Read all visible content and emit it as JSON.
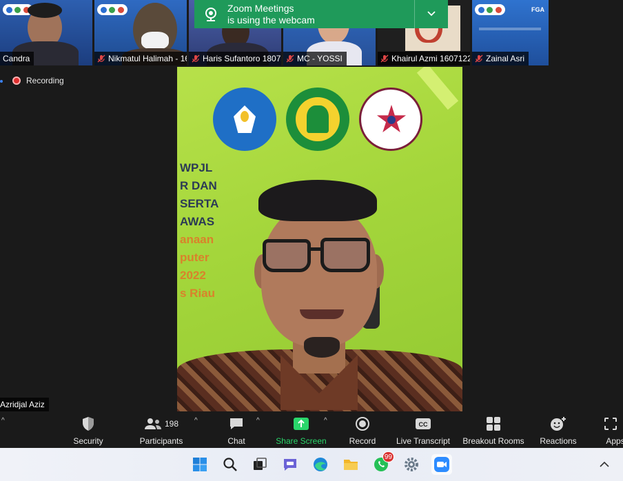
{
  "notification": {
    "title": "Zoom Meetings",
    "message": "is using the webcam"
  },
  "participants": [
    {
      "name": "Candra",
      "muted": false
    },
    {
      "name": "Nikmatul Halimah - 16...",
      "muted": true
    },
    {
      "name": "Haris Sufantoro 18071...",
      "muted": true
    },
    {
      "name": "MC - YOSSI",
      "muted": true
    },
    {
      "name": "Khairul Azmi 1607122...",
      "muted": true
    },
    {
      "name": "Zainal Asri",
      "muted": true
    }
  ],
  "tile_logo_text": "FGA",
  "recording": {
    "label": "Recording"
  },
  "active_speaker": {
    "name": "Azridjal Aziz"
  },
  "poster": {
    "lines": [
      "WPJL",
      "R DAN",
      "SERTA",
      "AWAS",
      "anaan",
      "puter",
      "2022",
      "s Riau"
    ]
  },
  "toolbar": {
    "security": "Security",
    "participants": "Participants",
    "participants_count": "198",
    "chat": "Chat",
    "share_screen": "Share Screen",
    "record": "Record",
    "live_transcript": "Live Transcript",
    "breakout_rooms": "Breakout Rooms",
    "reactions": "Reactions",
    "apps": "Apps"
  },
  "taskbar": {
    "whatsapp_badge": "99",
    "icons": [
      "windows-start-icon",
      "search-icon",
      "task-view-icon",
      "teams-chat-icon",
      "edge-icon",
      "file-explorer-icon",
      "whatsapp-icon",
      "settings-icon",
      "zoom-icon"
    ]
  },
  "colors": {
    "toast_green": "#1f9a5a",
    "share_green": "#2ad66b",
    "poster_green": "#a4d63b",
    "record_red": "#e02f2f"
  }
}
